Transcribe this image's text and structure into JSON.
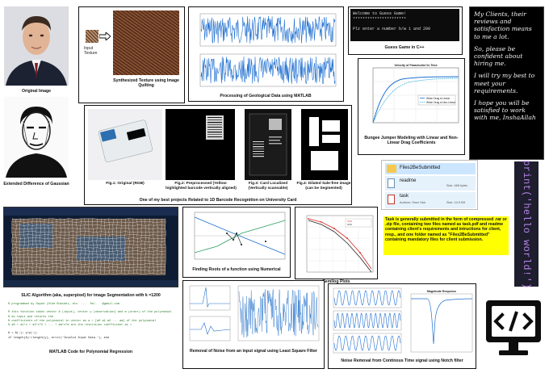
{
  "portrait": {
    "original_caption": "Original Image",
    "dog_caption": "Extended Difference of Gaussian"
  },
  "texture": {
    "input_label": "Input Texture",
    "output_caption": "Synthesized Texture using Image Quilting"
  },
  "geo": {
    "caption": "Processing of Geological Data using MATLAB"
  },
  "guess": {
    "line1": "Welcome to Guess Game!",
    "line2": "**********************",
    "line3": "Plz enter a number b/w 1 and 200",
    "caption": "Guess Game in C++"
  },
  "bungee": {
    "chart_title": "Velocity of Parachutist Vs Time",
    "legend_1": "When Drag is Linear",
    "legend_2": "When Drag is Non-Linear",
    "caption": "Bungee Jumper Modeling with Linear and Non-Linear Drag Coefficients"
  },
  "quote": {
    "p1": "My Clients, their reviews and satisfaction means to me a lot.",
    "p2": "So, please be confident about hiring me.",
    "p3": "I will try my best to meet your requirements.",
    "p4": "I hope you will be satisfied to work with me, InshaAllah"
  },
  "barcode": {
    "fig1": "Fig.1: Original (RGB)",
    "fig2": "Fig.2: Preprocessed (Yellow-highlighted barcode vertically aligned)",
    "fig3": "Fig.3: Card Localized (Vertically scannable)",
    "fig4": "Fig.4: Dilated Sale-free image (can be Segmented)",
    "caption": "One of my best projects Related to 1D Barcode Recognition on University Card"
  },
  "files": {
    "folder": "Files2BeSubmitted",
    "readme": "readme",
    "task": "task",
    "size_label_1": "Size: 468 bytes",
    "task_author": "Authors: Shon Vick",
    "size_label_2": "Size: 14.9 KB"
  },
  "hello": {
    "code": "print('hello world!')"
  },
  "submit_note": {
    "text_before": "Task is generally submitted in the form  of compressed .rar or .zip file, containing two files named as task.pdf and readme containing client's requirements and intructions for client, resp., and one folder named as ",
    "folder_name": "\"Files2BeSubmitted\"",
    "text_after": " containing mandatory files for client submission."
  },
  "slic": {
    "caption": "SLIC Algorithm (aka, superpixel) for image Segmentation with k =1200"
  },
  "roots": {
    "caption": "Finding Roots of a function using Numerical"
  },
  "semilog": {
    "caption": "Semilog Plots"
  },
  "poly": {
    "code_lines": [
      "% programmed by Sayed (Olde Rubidei, etc  ...  fm/-   @gmail.com",
      "",
      "% this function takes vector A (input), vector y (observation) and m (order) of the polynomial",
      "% as input and returns the",
      "% coefficients of the polynomial in vector as a = [a0 a1 a2 ... am] of the polynomial",
      "% a0 + a1*x + a2*x^2 + ... + am*x^m are the resolution coefficient as =",
      "",
      "A = A(:); y=y(:);",
      "if length(A)~=length(y), error('Invalid Input Data.'), end"
    ],
    "caption": "MATLAB Code for Polynomial Regression"
  },
  "noise_ls": {
    "caption": "Removal of Noise from an input signal using Least Square Filter"
  },
  "notch": {
    "chart_title": "Magnitude Response",
    "caption": "Noise Removal from Continous Time signal using Notch filter"
  },
  "code_icon": {
    "symbol": "</>"
  },
  "colors": {
    "yellow_note": "#ffff00",
    "terminal_bg": "#0c0c0c",
    "quote_bg": "#000000",
    "plot_blue": "#1f6fd0",
    "hello_purple": "#9b5fd6"
  }
}
